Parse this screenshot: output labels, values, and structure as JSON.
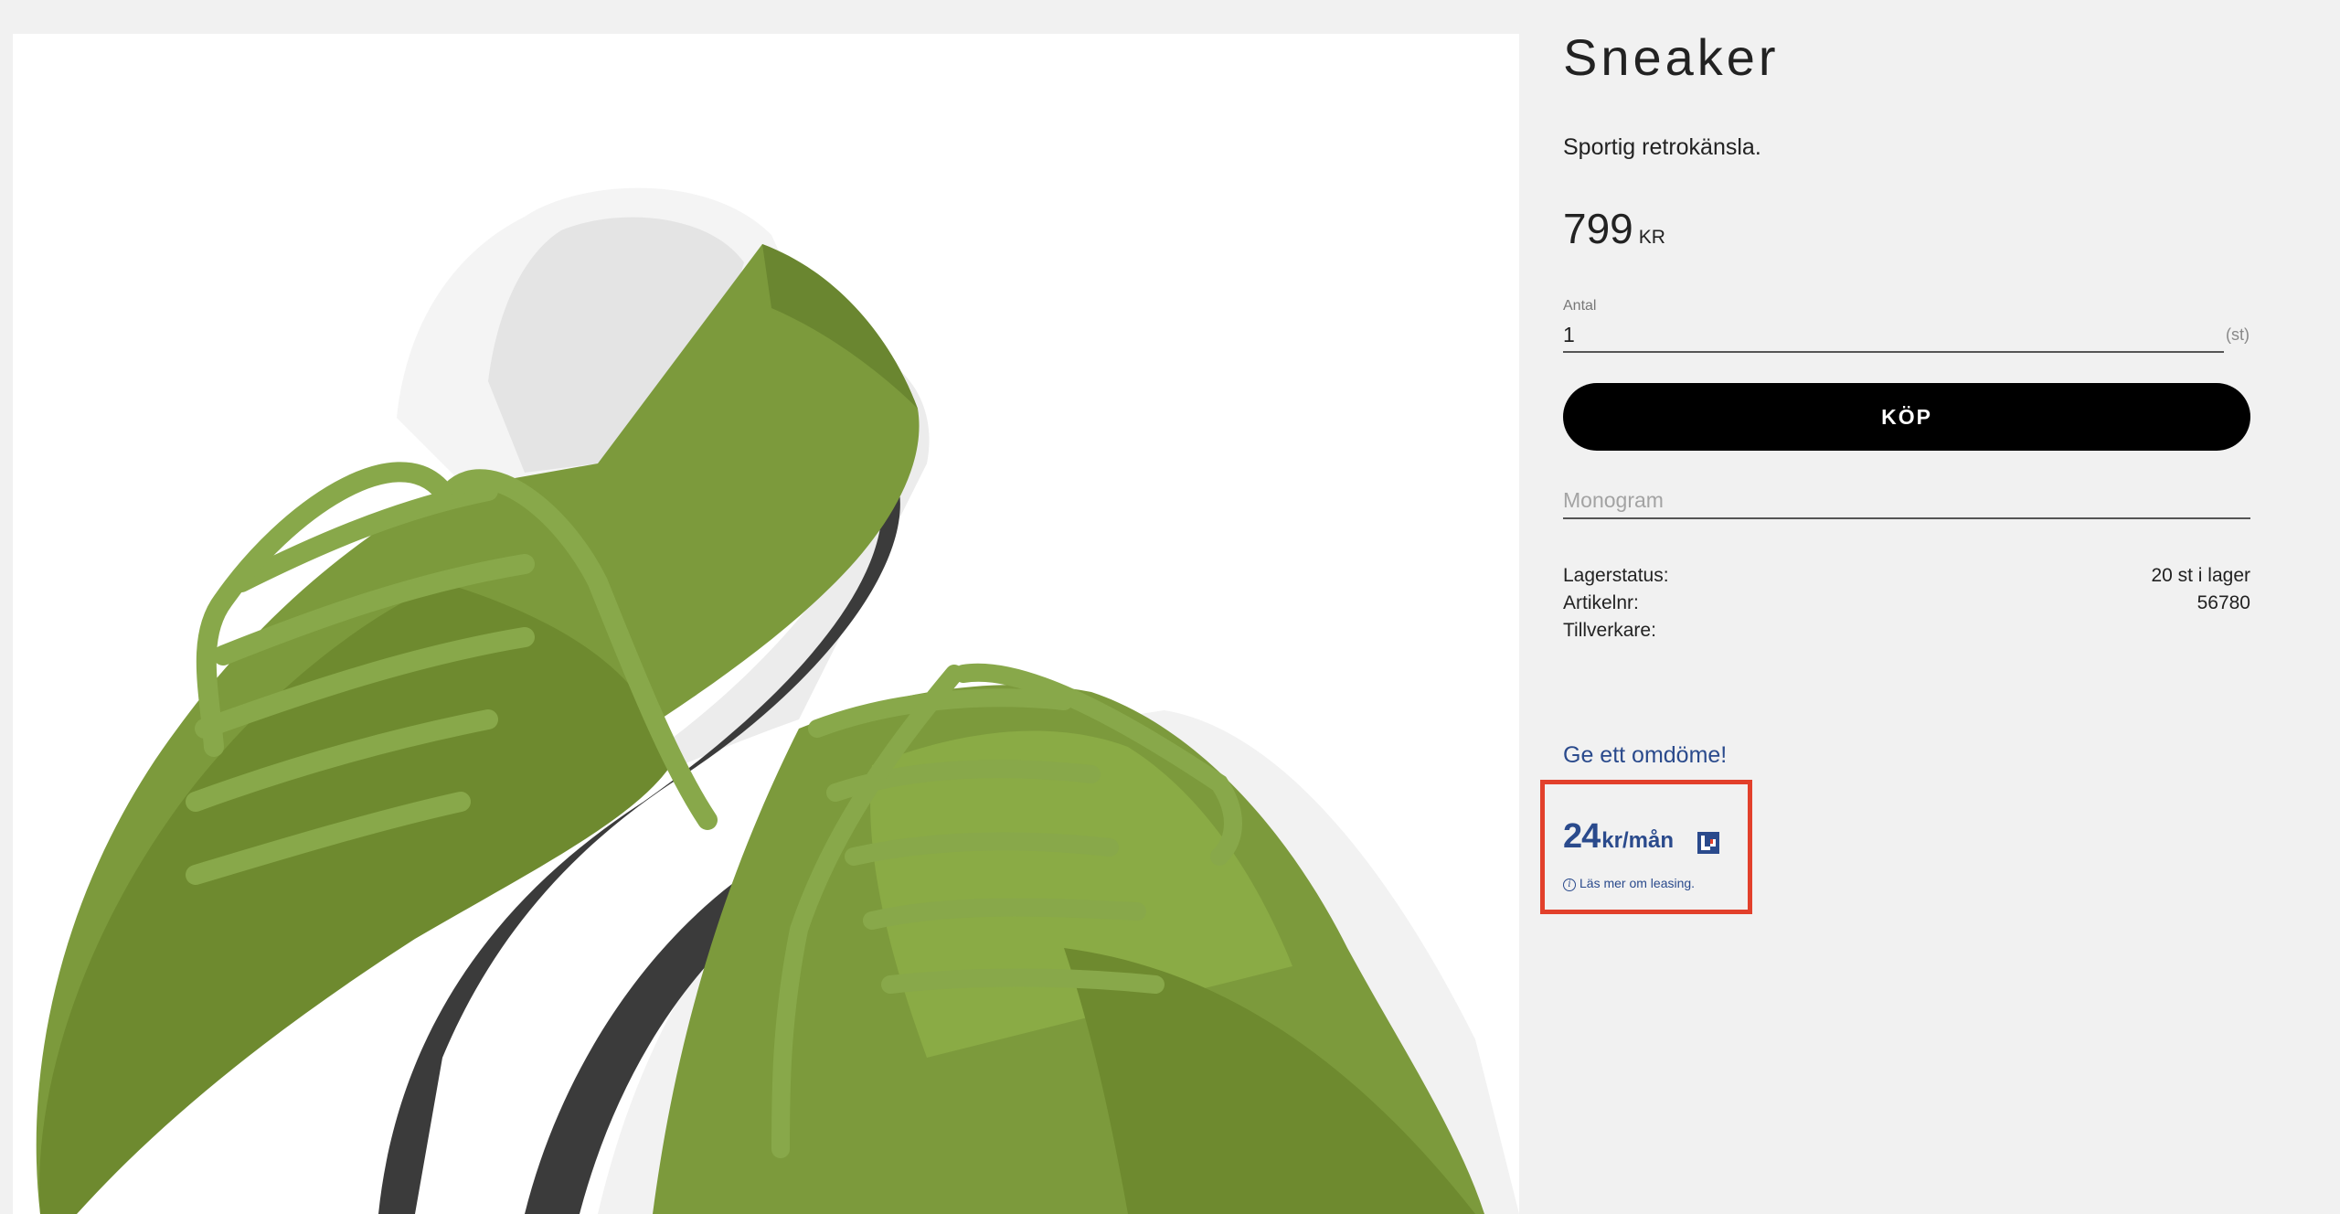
{
  "product": {
    "title": "Sneaker",
    "subtitle": "Sportig retrokänsla.",
    "price": {
      "amount": "799",
      "currency": "KR"
    },
    "image_icon": "sneaker-photo"
  },
  "quantity": {
    "label": "Antal",
    "value": "1",
    "unit": "(st)"
  },
  "buy_label": "KÖP",
  "monogram": {
    "placeholder": "Monogram",
    "value": ""
  },
  "specs": [
    {
      "label": "Lagerstatus:",
      "value": "20 st i lager"
    },
    {
      "label": "Artikelnr:",
      "value": "56780"
    },
    {
      "label": "Tillverkare:",
      "value": ""
    }
  ],
  "review_link": "Ge ett omdöme!",
  "leasing": {
    "amount": "24",
    "unit": "kr/mån",
    "info_text": "Läs mer om leasing.",
    "info_icon": "info-icon",
    "logo_icon": "leasing-logo-icon",
    "highlight_color": "#e2402b",
    "text_color": "#2a4a8c"
  },
  "colors": {
    "background": "#f1f1f1",
    "button": "#000000",
    "link": "#2a4a8c"
  }
}
